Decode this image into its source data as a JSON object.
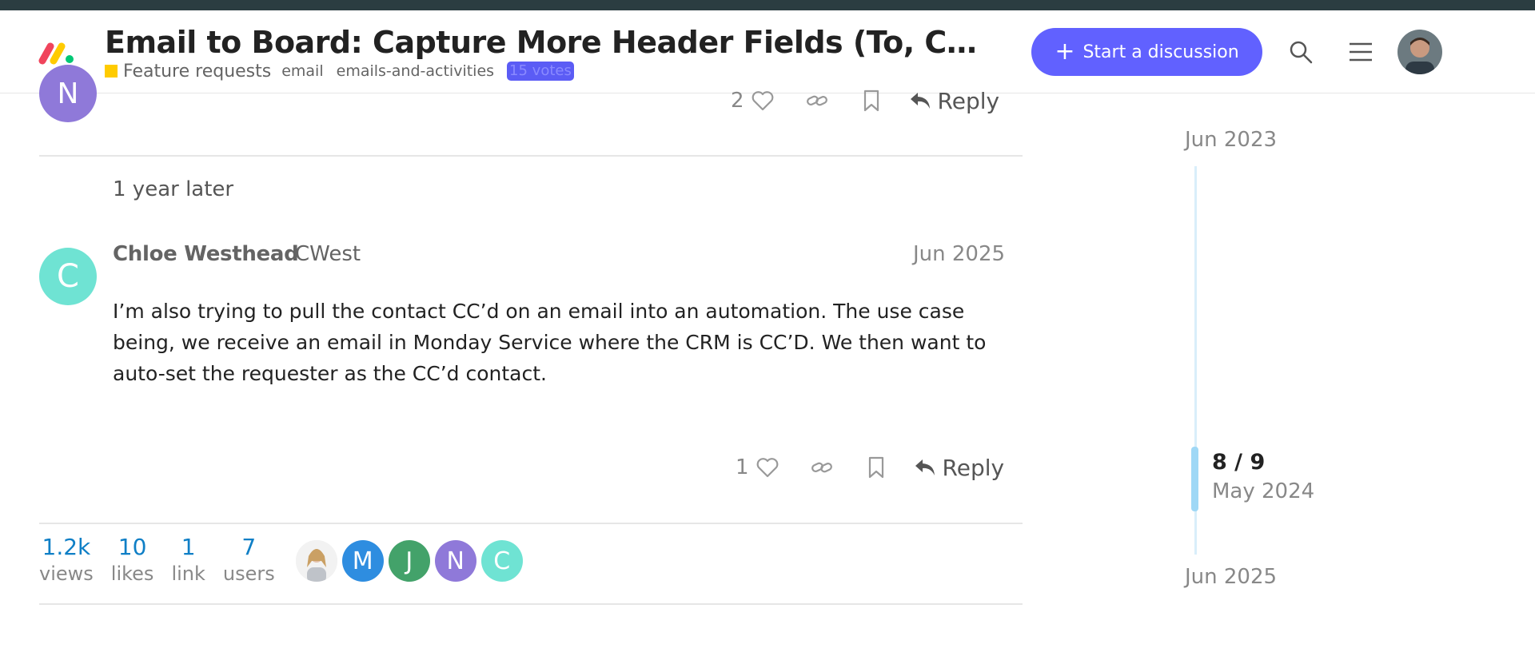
{
  "header": {
    "title": "Email to Board: Capture More Header Fields (To, CC, From) and Add Subject/Body Parsing",
    "category": "Feature requests",
    "category_color": "#ffcb00",
    "tags": [
      "email",
      "emails-and-activities"
    ],
    "votes": "15 votes",
    "start_button_label": "Start a discussion",
    "accent_color": "#6161ff",
    "icons": [
      "search-icon",
      "menu-icon",
      "user-avatar"
    ]
  },
  "previous_post": {
    "avatar_letter": "N",
    "like_count": "2",
    "reply_label": "Reply"
  },
  "time_gap": "1 year later",
  "post": {
    "avatar_letter": "C",
    "author_name": "Chloe Westhead",
    "author_username": "CWest",
    "date": "Jun 2025",
    "body": "I’m also trying to pull the contact CC’d on an email into an automation. The use case being, we receive an email in Monday Service where the CRM is CC’D. We then want to auto-set the requester as the CC’d contact.",
    "like_count": "1",
    "reply_label": "Reply"
  },
  "stats": [
    {
      "value": "1.2k",
      "label": "views"
    },
    {
      "value": "10",
      "label": "likes"
    },
    {
      "value": "1",
      "label": "link"
    },
    {
      "value": "7",
      "label": "users"
    }
  ],
  "participants": [
    {
      "letter": "",
      "color": "#e8e8e8"
    },
    {
      "letter": "M",
      "color": "#2e8de0"
    },
    {
      "letter": "J",
      "color": "#43a26a"
    },
    {
      "letter": "N",
      "color": "#8f79d9"
    },
    {
      "letter": "C",
      "color": "#6fe3d3"
    }
  ],
  "timeline": {
    "top_date": "Jun 2023",
    "position": "8 / 9",
    "current_date": "May 2024",
    "bottom_date": "Jun 2025"
  }
}
